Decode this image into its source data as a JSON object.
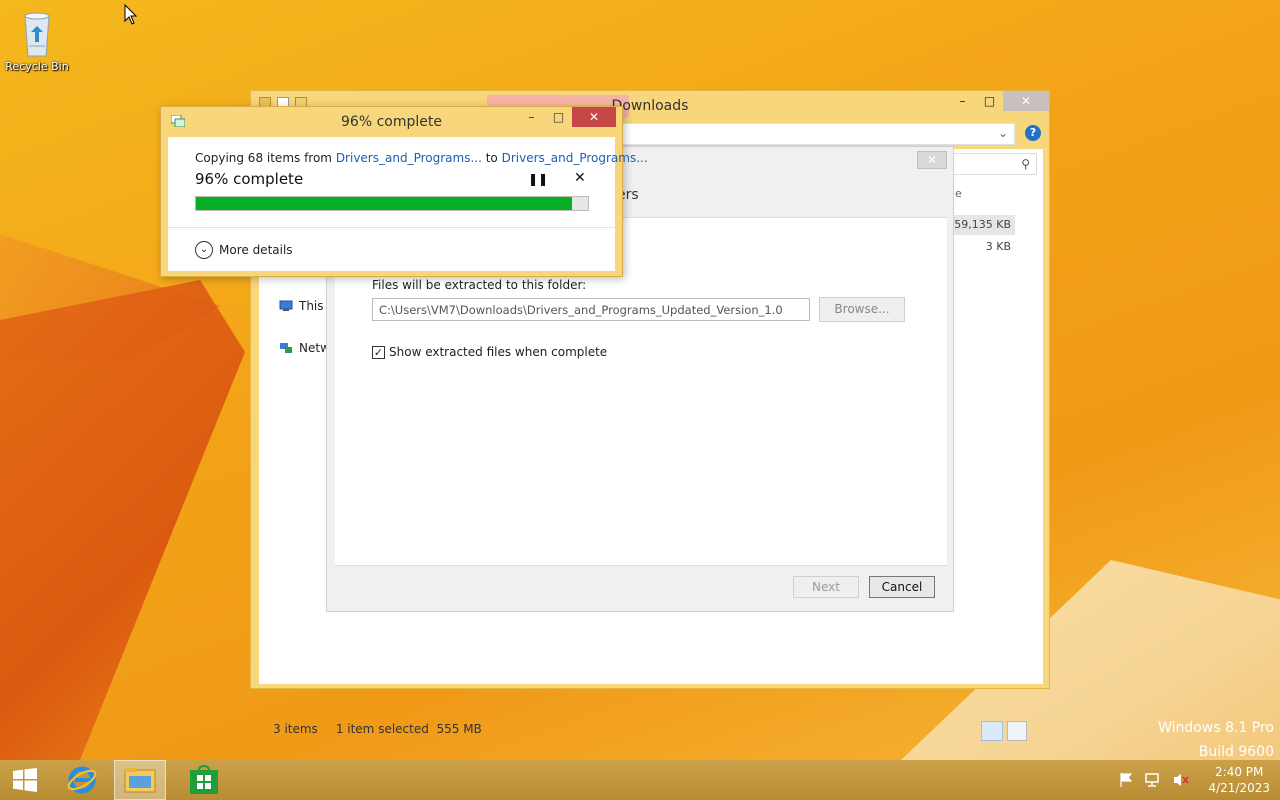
{
  "desktop": {
    "recycle_bin_label": "Recycle Bin",
    "watermark_line1": "Windows 8.1 Pro",
    "watermark_line2": "Build 9600"
  },
  "explorer": {
    "title": "Downloads",
    "nav": {
      "this_pc": "This I",
      "network": "Netw"
    },
    "column_partial": "e",
    "header_partial": "ers",
    "file_sizes": [
      "59,135 KB",
      "3 KB"
    ],
    "status": {
      "items": "3 items",
      "selected": "1 item selected",
      "size": "555 MB"
    }
  },
  "wizard": {
    "folder_label": "Files will be extracted to this folder:",
    "path_value": "C:\\Users\\VM7\\Downloads\\Drivers_and_Programs_Updated_Version_1.0",
    "browse_label": "Browse...",
    "show_files_label": "Show extracted files when complete",
    "show_files_checked": true,
    "next_label": "Next",
    "cancel_label": "Cancel"
  },
  "copy_dialog": {
    "title": "96% complete",
    "line_prefix": "Copying 68 items from ",
    "source": "Drivers_and_Programs...",
    "line_to": " to ",
    "destination": "Drivers_and_Programs...",
    "percent_label": "96% complete",
    "progress": 0.96,
    "more_details_label": "More details",
    "progress_color": "#06b025"
  },
  "taskbar": {
    "time": "2:40 PM",
    "date": "4/21/2023",
    "icons": [
      "start-icon",
      "internet-explorer-icon",
      "file-explorer-icon",
      "store-icon"
    ],
    "tray_icons": [
      "flag-icon",
      "network-icon",
      "volume-muted-icon"
    ]
  }
}
